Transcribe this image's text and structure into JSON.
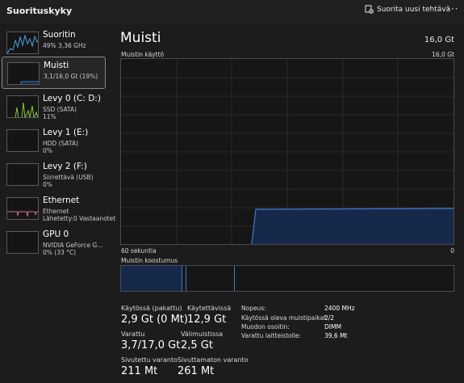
{
  "app": {
    "title": "Suorituskyky",
    "run_task_label": "Suorita uusi tehtävä",
    "more_label": "···"
  },
  "sidebar": {
    "items": [
      {
        "title": "Suoritin",
        "lines": [
          "49%  3,36 GHz"
        ],
        "color": "#4aa3df",
        "selected": false
      },
      {
        "title": "Muisti",
        "lines": [
          "3,1/16,0 Gt (19%)"
        ],
        "color": "#3d7cc9",
        "selected": true
      },
      {
        "title": "Levy 0 (C: D:)",
        "lines": [
          "SSD (SATA)",
          "11%"
        ],
        "color": "#8cc63f",
        "selected": false
      },
      {
        "title": "Levy 1 (E:)",
        "lines": [
          "HDD (SATA)",
          "0%"
        ],
        "color": "#8cc63f",
        "selected": false
      },
      {
        "title": "Levy 2 (F:)",
        "lines": [
          "Siirrettävä (USB)",
          "0%"
        ],
        "color": "#8cc63f",
        "selected": false
      },
      {
        "title": "Ethernet",
        "lines": [
          "Ethernet",
          "Lähetetty:0 Vastaanotet"
        ],
        "color": "#d36d8c",
        "selected": false
      },
      {
        "title": "GPU 0",
        "lines": [
          "NVIDIA GeForce G...",
          "0%  (33 °C)"
        ],
        "color": "#4aa3df",
        "selected": false
      }
    ]
  },
  "main": {
    "title": "Muisti",
    "total": "16,0 Gt",
    "usage_label": "Muistin käyttö",
    "usage_max": "16,0 Gt",
    "time_left": "60 sekuntia",
    "time_right": "0",
    "composition_label": "Muistin koostumus",
    "usage_fraction": 0.19,
    "colors": {
      "accent": "#3d7cc9",
      "fill": "#16294a",
      "grid": "#2a2a2a"
    }
  },
  "stats": {
    "in_use_label": "Käytössä (pakattu)",
    "in_use_value": "2,9 Gt (0 Mt)",
    "available_label": "Käytettävissä",
    "available_value": "12,9 Gt",
    "committed_label": "Varattu",
    "committed_value": "3,7/17,0 Gt",
    "cached_label": "Välimuistissa",
    "cached_value": "2,5 Gt",
    "paged_label": "Sivutettu varanto",
    "paged_value": "211 Mt",
    "nonpaged_label": "Sivuttamaton varanto",
    "nonpaged_value": "261 Mt"
  },
  "info": [
    {
      "label": "Nopeus:",
      "value": "2400 MHz"
    },
    {
      "label": "Käytössä oleva muistipaikat:",
      "value": "2/2"
    },
    {
      "label": "Muodon osoitin:",
      "value": "DIMM"
    },
    {
      "label": "Varattu laitteistolle:",
      "value": "39,6 Mt"
    }
  ]
}
